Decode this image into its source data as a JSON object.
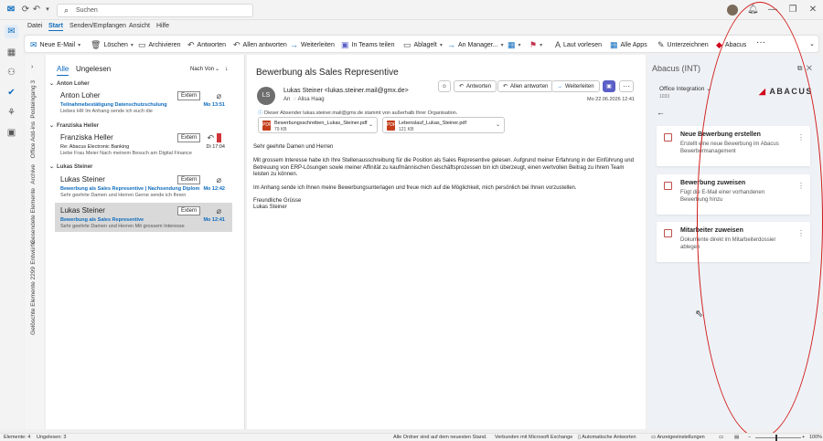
{
  "titlebar": {
    "search_placeholder": "Suchen"
  },
  "menu": {
    "items": [
      {
        "label": "Datei"
      },
      {
        "label": "Start"
      },
      {
        "label": "Senden/Empfangen"
      },
      {
        "label": "Ansicht"
      },
      {
        "label": "Hilfe"
      }
    ]
  },
  "ribbon": {
    "new_mail": "Neue E-Mail",
    "delete": "Löschen",
    "archive": "Archivieren",
    "reply": "Antworten",
    "reply_all": "Allen antworten",
    "forward": "Weiterleiten",
    "teams": "In Teams teilen",
    "inbox": "Ablagelt",
    "move": "An Manager...",
    "read_aloud": "Laut vorlesen",
    "apps": "Alle Apps",
    "sign": "Unterzeichnen",
    "abacus": "Abacus"
  },
  "folders": {
    "labels": [
      "Posteingang 3",
      "Office Add-ins",
      "Archive",
      "Gesendete Elemente",
      "Entwürfe",
      "Gelöschte Elemente 2299"
    ]
  },
  "maillist": {
    "tab_all": "Alle",
    "tab_unread": "Ungelesen",
    "sort": "Nach Von",
    "groups": [
      {
        "name": "Anton Loher",
        "items": [
          {
            "from": "Anton Loher",
            "tag": "Extern",
            "subject": "Teilnahmebestätigung Datenschutzschulung",
            "preview": "Liebes HR  Im Anhang sende ich euch die",
            "time": "Mo 13:51"
          }
        ]
      },
      {
        "name": "Franziska Heller",
        "items": [
          {
            "from": "Franziska Heller",
            "tag": "Extern",
            "subject": "Re: Abacus Electronic Banking",
            "preview": "Liebe Frau Meier  Nach meinem Besuch am Digital Finance",
            "time": "Di 17:04"
          }
        ]
      },
      {
        "name": "Lukas Steiner",
        "items": [
          {
            "from": "Lukas Steiner",
            "tag": "Extern",
            "subject": "Bewerbung als Sales Representive | Nachsendung Diplom",
            "preview": "Sehr geehrte Damen und Herren  Gerne sende ich Ihnen",
            "time": "Mo 12:42"
          },
          {
            "from": "Lukas Steiner",
            "tag": "Extern",
            "subject": "Bewerbung als Sales Representive",
            "preview": "Sehr geehrte Damen und Herren  Mit grossem Interesse",
            "time": "Mo 12:41"
          }
        ]
      }
    ]
  },
  "reading": {
    "subject": "Bewerbung als Sales Representive",
    "avatar": "LS",
    "sender": "Lukas Steiner <lukas.steiner.mail@gmx.de>",
    "to_label": "An",
    "recipient": "Alisa Haag",
    "actions": {
      "reply": "Antworten",
      "reply_all": "Allen antworten",
      "forward": "Weiterleiten"
    },
    "date": "Mo 22.06.2026 12:41",
    "info": "Dieser Absender lukas.steiner.mail@gmx.de stammt von außerhalb Ihrer Organisation.",
    "attachments": [
      {
        "name": "Bewerbungsschreiben_Lukas_Steiner.pdf",
        "size": "79 KB"
      },
      {
        "name": "Lebenslauf_Lukas_Steiner.pdf",
        "size": "121 KB"
      }
    ],
    "body": [
      "Sehr geehrte Damen und Herren",
      "Mit grossem Interesse habe ich Ihre Stellenausschreibung für die Position als Sales Representive gelesen. Aufgrund meiner Erfahrung in der Einführung und Betreuung von ERP-Lösungen sowie meiner Affinität zu kaufmännischen Geschäftsprozessen bin ich überzeugt, einen wertvollen Beitrag zu Ihrem Team leisten zu können.",
      "Im Anhang sende ich Ihnen meine Bewerbungsunterlagen und freue mich auf die Möglichkeit, mich persönlich bei Ihnen vorzustellen.",
      "Freundliche Grüsse",
      "Lukas Steiner"
    ]
  },
  "sidepanel": {
    "title": "Abacus (INT)",
    "integration": "Office Integration",
    "integration_num": "1033",
    "logo_text": "ABACUS",
    "cards": [
      {
        "title": "Neue Bewerbung erstellen",
        "desc": "Erstellt eine neue Bewerbung im Abacus Bewerbermanagement"
      },
      {
        "title": "Bewerbung zuweisen",
        "desc": "Fügt die E-Mail einer vorhandenen Bewerbung hinzu"
      },
      {
        "title": "Mitarbeiter zuweisen",
        "desc": "Dokumente direkt im Mitarbeiterdossier ablegen"
      }
    ]
  },
  "statusbar": {
    "elements": "Elemente: 4",
    "unread": "Ungelesen: 3",
    "folders_status": "Alle Ordner sind auf dem neuesten Stand.",
    "connected": "Verbunden mit Microsoft Exchange",
    "auto_reply": "Automatische Antworten",
    "display_settings": "Anzeigeeinstellungen",
    "zoom": "100%"
  },
  "colors": {
    "accent": "#0f6cbd",
    "annotation": "#d21a1a"
  }
}
